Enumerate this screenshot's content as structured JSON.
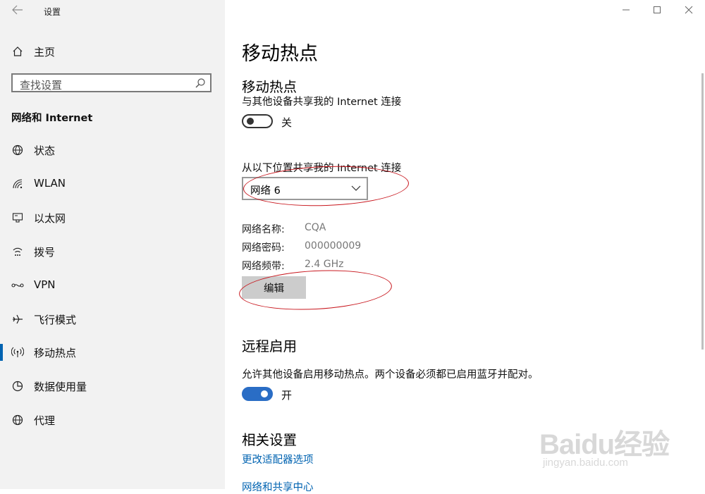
{
  "app_title": "设置",
  "sidebar": {
    "home_label": "主页",
    "search_placeholder": "查找设置",
    "section_title": "网络和 Internet",
    "items": [
      {
        "label": "状态",
        "icon": "globe-icon"
      },
      {
        "label": "WLAN",
        "icon": "wifi-icon"
      },
      {
        "label": "以太网",
        "icon": "ethernet-icon"
      },
      {
        "label": "拨号",
        "icon": "dialup-icon"
      },
      {
        "label": "VPN",
        "icon": "vpn-icon"
      },
      {
        "label": "飞行模式",
        "icon": "airplane-icon"
      },
      {
        "label": "移动热点",
        "icon": "hotspot-icon",
        "selected": true
      },
      {
        "label": "数据使用量",
        "icon": "data-usage-icon"
      },
      {
        "label": "代理",
        "icon": "proxy-icon"
      }
    ]
  },
  "main": {
    "page_title": "移动热点",
    "hotspot": {
      "heading": "移动热点",
      "description": "与其他设备共享我的 Internet 连接",
      "toggle_state": "关",
      "share_from_label": "从以下位置共享我的 Internet 连接",
      "share_from_value": "网络 6",
      "props": [
        {
          "label": "网络名称:",
          "value": "CQA"
        },
        {
          "label": "网络密码:",
          "value": "000000009"
        },
        {
          "label": "网络频带:",
          "value": "2.4 GHz"
        }
      ],
      "edit_button": "编辑"
    },
    "remote": {
      "heading": "远程启用",
      "description": "允许其他设备启用移动热点。两个设备必须都已启用蓝牙并配对。",
      "toggle_state": "开"
    },
    "related": {
      "heading": "相关设置",
      "links": [
        "更改适配器选项",
        "网络和共享中心"
      ]
    }
  },
  "watermark": {
    "brand": "Baidu经验",
    "url": "jingyan.baidu.com"
  },
  "colors": {
    "accent": "#0063b1",
    "toggle_on": "#2a6dc5",
    "annotation": "#c8161d"
  }
}
